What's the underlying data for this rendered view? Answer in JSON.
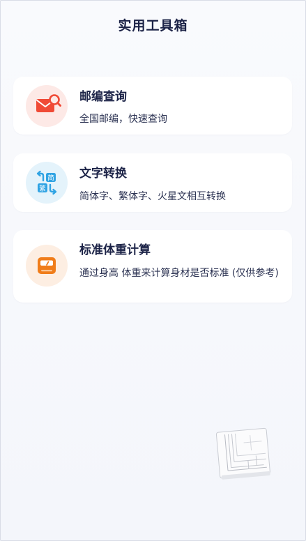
{
  "header": {
    "title": "实用工具箱"
  },
  "tools": [
    {
      "title": "邮编查询",
      "description": "全国邮编，快速查询",
      "icon": "mail-search-icon",
      "icon_bg": "#fde9e6",
      "icon_color": "#f04a36"
    },
    {
      "title": "文字转换",
      "description": "简体字、繁体字、火星文相互转换",
      "icon": "text-convert-icon",
      "icon_bg": "#e4f3fb",
      "icon_color": "#2fa3e3",
      "icon_labels": {
        "simplified": "简",
        "traditional": "繁"
      }
    },
    {
      "title": "标准体重计算",
      "description": "通过身高 体重来计算身材是否标准 (仅供参考)",
      "icon": "scale-icon",
      "icon_bg": "#fdeee2",
      "icon_color": "#f07d1a"
    }
  ],
  "floating_widget": {
    "icon": "layout-grid-icon"
  },
  "colors": {
    "background": "#f6f7fb",
    "card": "#ffffff",
    "text_primary": "#1c2347"
  }
}
